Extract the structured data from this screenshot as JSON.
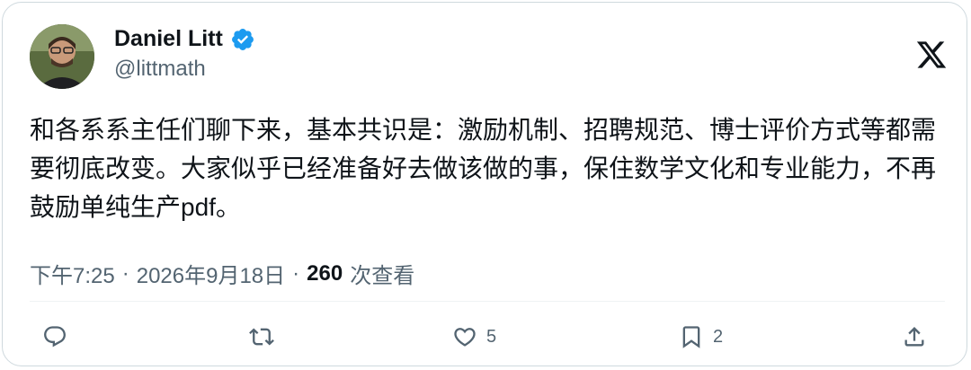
{
  "author": {
    "name": "Daniel Litt",
    "handle": "@littmath",
    "verified": true
  },
  "tweet": {
    "text": "和各系系主任们聊下来，基本共识是：激励机制、招聘规范、博士评价方式等都需要彻底改变。大家似乎已经准备好去做该做的事，保住数学文化和专业能力，不再鼓励单纯生产pdf。"
  },
  "meta": {
    "time": "下午7:25",
    "separator": "·",
    "date": "2026年9月18日",
    "views_count": "260",
    "views_label": "次查看"
  },
  "actions": {
    "reply_count": "",
    "retweet_count": "",
    "like_count": "5",
    "bookmark_count": "2"
  },
  "icons": {
    "brand": "x-logo-icon",
    "verified": "verified-badge-icon",
    "reply": "reply-icon",
    "retweet": "retweet-icon",
    "like": "heart-icon",
    "bookmark": "bookmark-icon",
    "share": "share-icon"
  },
  "colors": {
    "text": "#0f1419",
    "secondary": "#536471",
    "verified": "#1d9bf0",
    "border": "#cfd9de"
  }
}
